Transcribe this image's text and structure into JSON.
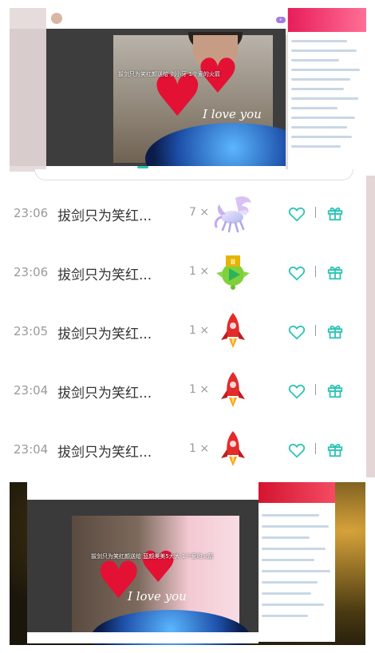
{
  "top_screenshot": {
    "gift_text": "拔剑只为笑红颜送给 刘小牙 1个爱的火箭",
    "love_text": "I love you"
  },
  "gifts": [
    {
      "time": "23:06",
      "sender": "拔剑只为笑红...",
      "count": "7 ×",
      "gift_icon": "pegasus-icon"
    },
    {
      "time": "23:06",
      "sender": "拔剑只为笑红...",
      "count": "1 ×",
      "gift_icon": "green-badge-icon"
    },
    {
      "time": "23:05",
      "sender": "拔剑只为笑红...",
      "count": "1 ×",
      "gift_icon": "rocket-icon"
    },
    {
      "time": "23:04",
      "sender": "拔剑只为笑红...",
      "count": "1 ×",
      "gift_icon": "rocket-icon"
    },
    {
      "time": "23:04",
      "sender": "拔剑只为笑红...",
      "count": "1 ×",
      "gift_icon": "rocket-icon"
    }
  ],
  "bottom_screenshot": {
    "gift_text": "拔剑只为笑红颜送给 蓝颜美美5大大 1个爱的火箭",
    "love_text": "I love you"
  },
  "colors": {
    "action_teal": "#2ec4b6",
    "text_gray": "#9a9a9a",
    "text_dark": "#333333",
    "heart_red": "#e31133"
  }
}
